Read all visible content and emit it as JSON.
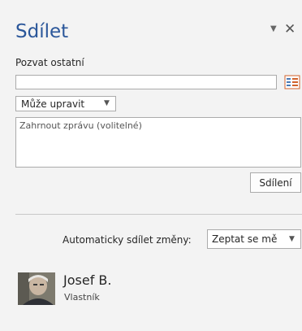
{
  "pane": {
    "title": "Sdílet",
    "menu_icon": "chevron-down-icon",
    "close_icon": "close-icon"
  },
  "invite": {
    "label": "Pozvat ostatní",
    "value": "",
    "address_book_icon": "address-book-icon",
    "permission": "Může upravit",
    "message_placeholder": "Zahrnout zprávu (volitelné)",
    "share_button": "Sdílení"
  },
  "auto_share": {
    "label": "Automaticky sdílet změny:",
    "value": "Zeptat se mě"
  },
  "user": {
    "name": "Josef B.",
    "role": "Vlastník"
  },
  "colors": {
    "accent": "#2b579a",
    "background": "#f3f3f3"
  }
}
